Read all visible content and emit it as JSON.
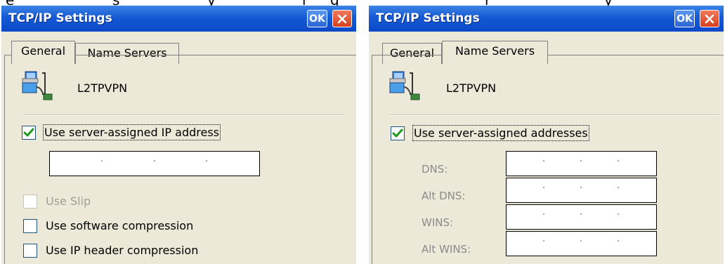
{
  "top_fragments": [
    "e",
    "s",
    "y",
    "i",
    "g",
    "r",
    "y"
  ],
  "dialogs": [
    {
      "title": "TCP/IP Settings",
      "ok_label": "OK",
      "tabs": [
        "General",
        "Name Servers"
      ],
      "active_tab": "General",
      "connection_name": "L2TPVPN",
      "use_server_ip": {
        "label": "Use server-assigned IP address",
        "checked": true
      },
      "use_slip": {
        "label": "Use Slip",
        "checked": false,
        "enabled": false
      },
      "software_compression": {
        "label": "Use software compression",
        "checked": false
      },
      "ip_header_compression": {
        "label": "Use IP header compression",
        "checked": false
      }
    },
    {
      "title": "TCP/IP Settings",
      "ok_label": "OK",
      "tabs": [
        "General",
        "Name Servers"
      ],
      "active_tab": "Name Servers",
      "connection_name": "L2TPVPN",
      "use_server_addresses": {
        "label": "Use server-assigned addresses",
        "checked": true
      },
      "dns_fields": [
        {
          "label": "DNS:"
        },
        {
          "label": "Alt DNS:"
        },
        {
          "label": "WINS:"
        },
        {
          "label": "Alt WINS:"
        }
      ]
    }
  ],
  "colors": {
    "titlebar": "#0a49c8",
    "dialog_bg": "#ece9d8",
    "check_green": "#1a9a1a",
    "close_red": "#d5401c"
  }
}
